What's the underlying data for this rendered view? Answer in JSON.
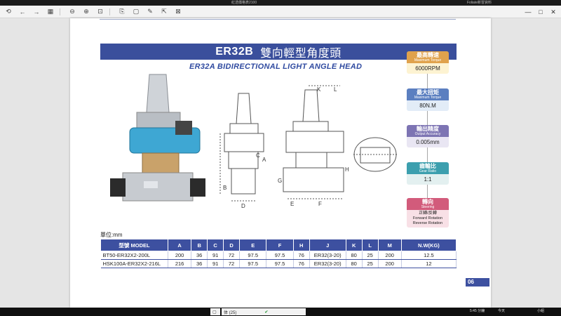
{
  "window": {
    "tabs": [
      "紅透價格表2100",
      "Foliate新冒資料"
    ],
    "controls": [
      "—",
      "□",
      "✕"
    ]
  },
  "toolbar": {
    "icons": [
      "back-icon",
      "forward-icon",
      "grid-icon",
      "zoom-out-icon",
      "zoom-in-icon",
      "fit-icon",
      "rotate-icon",
      "select-icon",
      "edit-icon",
      "export-icon",
      "close-icon"
    ]
  },
  "document": {
    "title_model": "ER32B",
    "title_zh": "雙向輕型角度頭",
    "subtitle": "ER32A BIDIRECTIONAL LIGHT ANGLE HEAD",
    "unit_label": "單位:mm",
    "page_number": "06",
    "dim_labels": [
      "K",
      "L",
      "C",
      "A",
      "B",
      "D",
      "E",
      "F",
      "G",
      "H"
    ],
    "specs": [
      {
        "zh": "最高轉速",
        "en": "Maximum Torque",
        "value": "6000RPM"
      },
      {
        "zh": "最大扭矩",
        "en": "Maximum Torque",
        "value": "80N.M"
      },
      {
        "zh": "輸出精度",
        "en": "Output Accuracy",
        "value": "0.005mm"
      },
      {
        "zh": "齒輪比",
        "en": "Gear Ratio",
        "value": "1:1"
      },
      {
        "zh": "轉向",
        "en": "Steering",
        "value": "正轉/反轉",
        "value2": "Forward Rotation",
        "value3": "Reverse Rotation"
      }
    ],
    "table": {
      "headers": [
        "型號 MODEL",
        "A",
        "B",
        "C",
        "D",
        "E",
        "F",
        "H",
        "J",
        "K",
        "L",
        "M",
        "N.W(KG)"
      ],
      "rows": [
        [
          "BT50-ER32X2-200L",
          "200",
          "36",
          "91",
          "72",
          "97.5",
          "97.5",
          "76",
          "ER32(3-20)",
          "80",
          "25",
          "200",
          "12.5"
        ],
        [
          "HSK100A-ER32X2-216L",
          "216",
          "36",
          "91",
          "72",
          "97.5",
          "97.5",
          "76",
          "ER32(3-20)",
          "80",
          "25",
          "200",
          "12"
        ]
      ]
    }
  },
  "taskbar": {
    "items": [
      "体 (25)"
    ],
    "tray": [
      "5:45 分鐘",
      "今天",
      "小組"
    ]
  },
  "colors": {
    "banner": "#3a4f9c",
    "accent_text": "#2f4aa0"
  }
}
